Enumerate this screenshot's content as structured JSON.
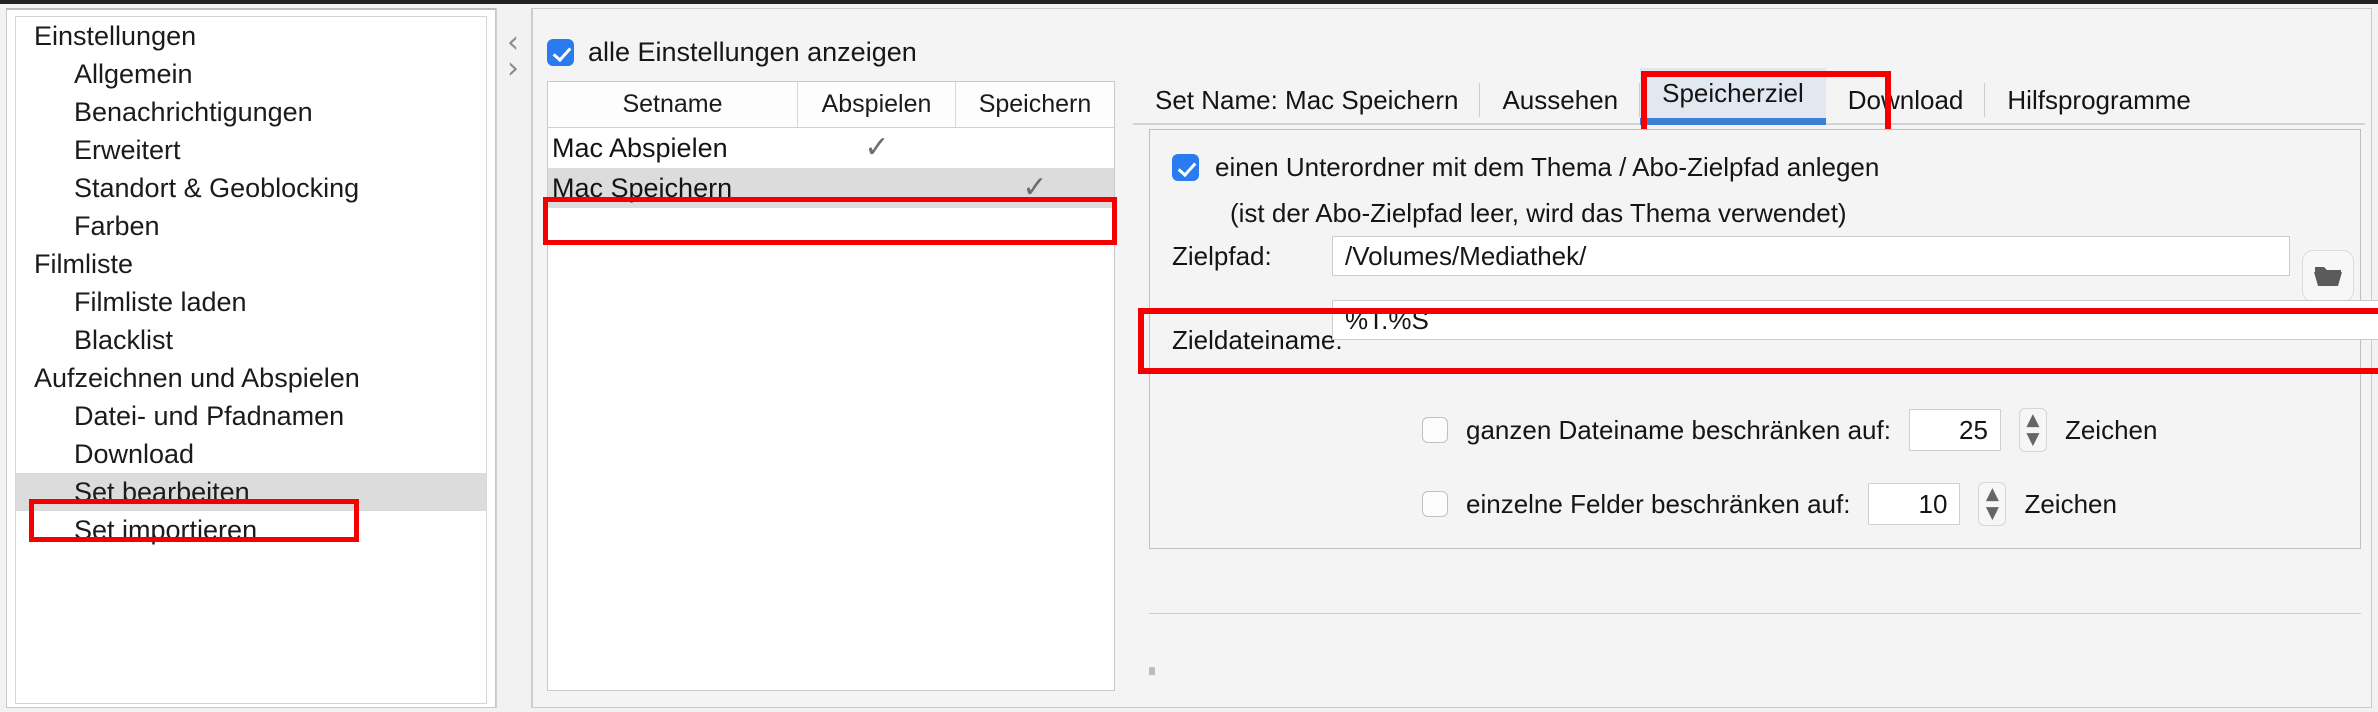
{
  "sidebar": {
    "items": [
      {
        "label": "Einstellungen",
        "level": 0,
        "selected": false
      },
      {
        "label": "Allgemein",
        "level": 1,
        "selected": false
      },
      {
        "label": "Benachrichtigungen",
        "level": 1,
        "selected": false
      },
      {
        "label": "Erweitert",
        "level": 1,
        "selected": false
      },
      {
        "label": "Standort & Geoblocking",
        "level": 1,
        "selected": false
      },
      {
        "label": "Farben",
        "level": 1,
        "selected": false
      },
      {
        "label": "Filmliste",
        "level": 0,
        "selected": false
      },
      {
        "label": "Filmliste laden",
        "level": 1,
        "selected": false
      },
      {
        "label": "Blacklist",
        "level": 1,
        "selected": false
      },
      {
        "label": "Aufzeichnen und Abspielen",
        "level": 0,
        "selected": false
      },
      {
        "label": "Datei- und Pfadnamen",
        "level": 1,
        "selected": false
      },
      {
        "label": "Download",
        "level": 1,
        "selected": false
      },
      {
        "label": "Set bearbeiten",
        "level": 1,
        "selected": true
      },
      {
        "label": "Set importieren",
        "level": 1,
        "selected": false
      }
    ]
  },
  "splitter": {
    "collapse_icon": "‹",
    "expand_icon": "›"
  },
  "main": {
    "show_all_settings": {
      "label": "alle Einstellungen anzeigen",
      "checked": true
    },
    "set_table": {
      "columns": [
        "Setname",
        "Abspielen",
        "Speichern"
      ],
      "rows": [
        {
          "name": "Mac Abspielen",
          "abspielen": "✓",
          "speichern": "",
          "selected": false
        },
        {
          "name": "Mac Speichern",
          "abspielen": "",
          "speichern": "✓",
          "selected": true
        }
      ]
    },
    "tabs": [
      {
        "label": "Set Name: Mac Speichern",
        "active": false
      },
      {
        "label": "Aussehen",
        "active": false
      },
      {
        "label": "Speicherziel",
        "active": true
      },
      {
        "label": "Download",
        "active": false
      },
      {
        "label": "Hilfsprogramme",
        "active": false
      }
    ],
    "panel": {
      "subfolder": {
        "label": "einen Unterordner mit dem Thema / Abo-Zielpfad anlegen",
        "checked": true,
        "hint": "(ist der Abo-Zielpfad leer, wird das Thema verwendet)"
      },
      "zielpfad": {
        "label": "Zielpfad:",
        "value": "/Volumes/Mediathek/",
        "browse_icon": "folder-icon"
      },
      "zieldateiname": {
        "label": "Zieldateiname:",
        "value": "%T.%S"
      },
      "limits": [
        {
          "label": "ganzen Dateiname beschränken auf:",
          "checked": false,
          "value": "25",
          "unit": "Zeichen"
        },
        {
          "label": "einzelne Felder beschränken auf:",
          "checked": false,
          "value": "10",
          "unit": "Zeichen"
        }
      ]
    }
  },
  "annotations": {
    "highlight_color": "#f40000",
    "accent_color": "#2a7bf0",
    "tab_accent_color": "#3c7fd4"
  }
}
